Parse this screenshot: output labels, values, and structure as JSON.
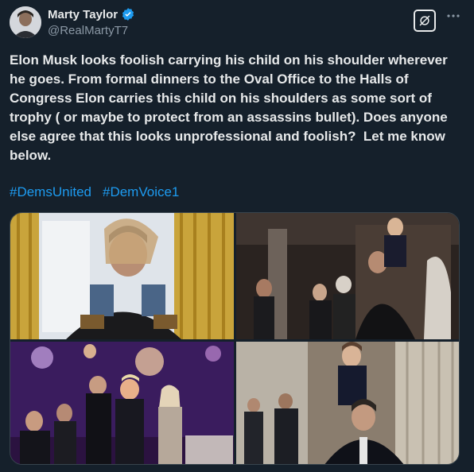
{
  "author": {
    "display_name": "Marty Taylor",
    "handle": "@RealMartyT7",
    "avatar_icon": "profile-avatar",
    "verified_icon": "verified-badge-icon"
  },
  "header_actions": {
    "grok_icon": "grok-icon",
    "more_icon": "more-horizontal-icon"
  },
  "tweet": {
    "text": "Elon Musk looks foolish carrying his child on his shoulder wherever\nhe goes. From formal dinners to the Oval Office to the Halls of\nCongress Elon carries this child on his shoulders as some sort of\ntrophy ( or maybe to protect from an assassins bullet). Does anyone\nelse agree that this looks unprofessional and foolish?  Let me know\nbelow.",
    "hashtags": [
      "#DemsUnited",
      "#DemVoice1"
    ]
  },
  "colors": {
    "background": "#15202b",
    "text": "#e7e9ea",
    "muted": "#8b98a5",
    "link": "#1d9bf0",
    "verified": "#1d9bf0"
  }
}
